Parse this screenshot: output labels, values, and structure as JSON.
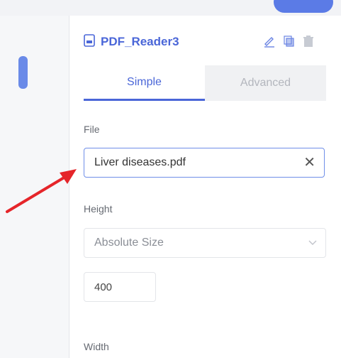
{
  "panel": {
    "title": "PDF_Reader3",
    "file_icon": "pdf-file-icon",
    "actions": [
      "edit-icon",
      "copy-icon",
      "delete-icon"
    ]
  },
  "tabs": [
    {
      "label": "Simple",
      "active": true
    },
    {
      "label": "Advanced",
      "active": false
    }
  ],
  "file": {
    "label": "File",
    "value": "Liver diseases.pdf",
    "clear_icon": "✕"
  },
  "height": {
    "label": "Height",
    "select_value": "Absolute Size",
    "number_value": "400"
  },
  "width": {
    "label": "Width"
  },
  "colors": {
    "accent": "#4a66d8",
    "annotation_arrow": "#e5252a"
  }
}
